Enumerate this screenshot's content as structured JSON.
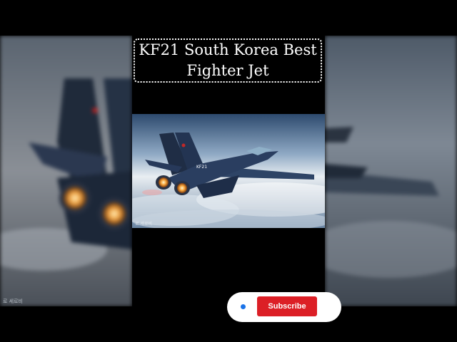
{
  "video": {
    "title_line1": "KF21 South Korea Best",
    "title_line2": "Fighter Jet",
    "image_label": "KF21 fighter jet over clouds",
    "image_marking": "KF21",
    "image_watermark": "로 세로비",
    "bg_watermark": "로 세로비"
  },
  "subscribe": {
    "label": "Subscribe"
  },
  "colors": {
    "subscribe_red": "#dc1f26",
    "indicator_blue": "#1a73e8",
    "title_border": "#ffffff"
  },
  "icons": {
    "indicator": "blue-dot-icon"
  }
}
